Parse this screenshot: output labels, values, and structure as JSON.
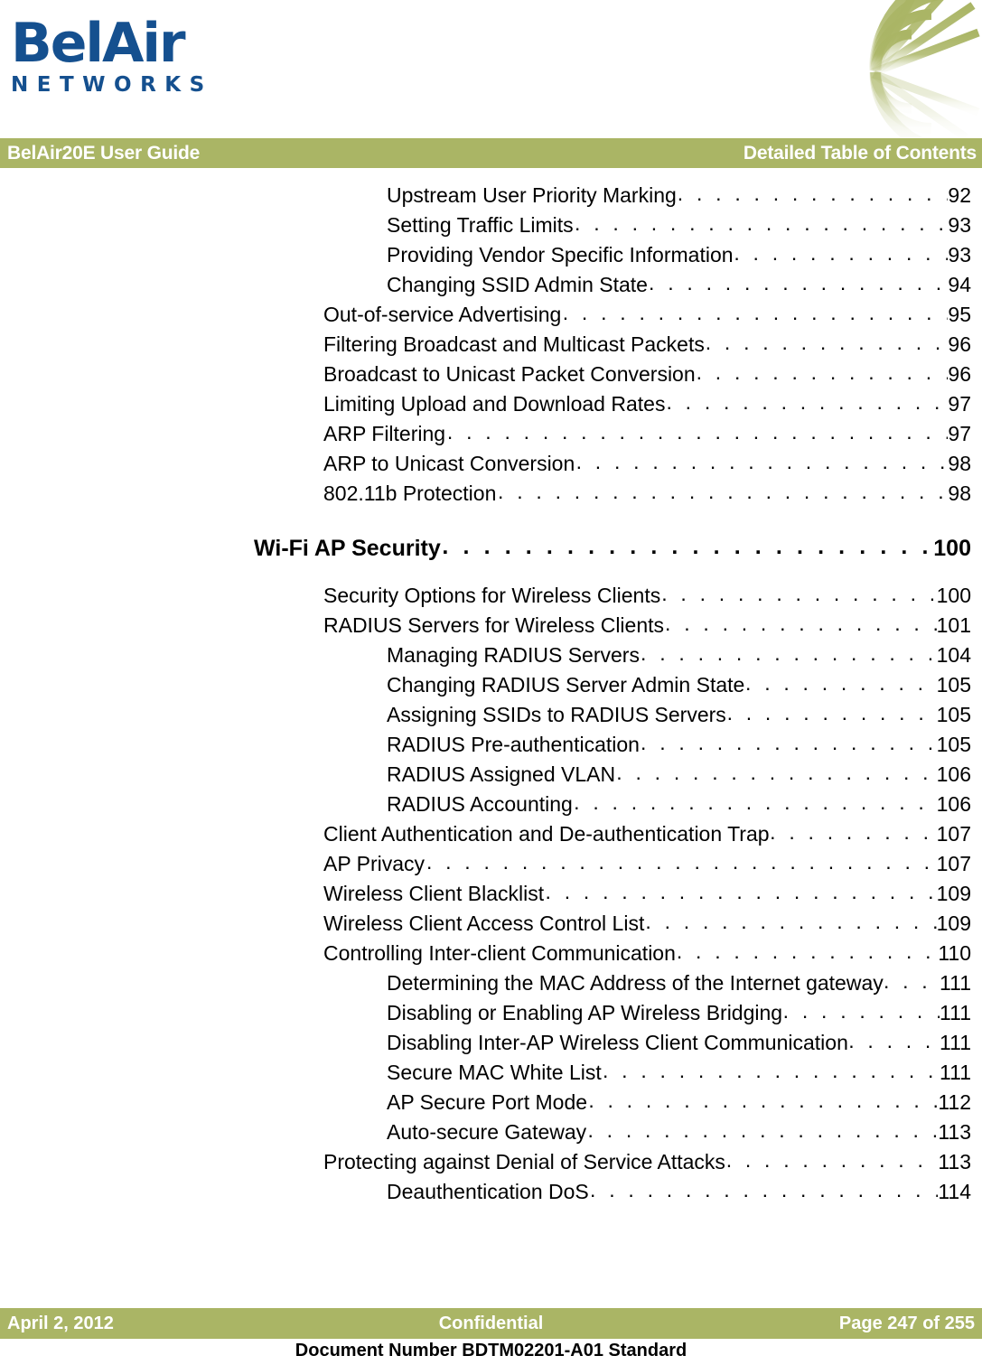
{
  "masthead": {
    "logo_word": "BelAir",
    "logo_sub": "NETWORKS",
    "logo_color": "#15508F",
    "brandmark_icon": "wireless-web-graphic",
    "brandmark_color": "#AAB565"
  },
  "header": {
    "left_title": "BelAir20E User Guide",
    "right_title": "Detailed Table of Contents",
    "band_color": "#AAB565",
    "text_color": "#FFFFFF"
  },
  "toc": {
    "leader_dots": ". . . . . . . . . . . . . . . . . . . . . . . . . . . . . . . . . . . . . . . . . . . . . . . . . . . . . . . . . . . . . . . . . . . . . . . . . . . . . . . . . . . . . .",
    "entries": [
      {
        "level": 2,
        "title": "Upstream User Priority Marking",
        "page": "92"
      },
      {
        "level": 2,
        "title": "Setting Traffic Limits",
        "page": "93"
      },
      {
        "level": 2,
        "title": "Providing Vendor Specific Information",
        "page": "93"
      },
      {
        "level": 2,
        "title": "Changing SSID Admin State",
        "page": "94"
      },
      {
        "level": 1,
        "title": "Out-of-service Advertising",
        "page": "95"
      },
      {
        "level": 1,
        "title": "Filtering Broadcast and Multicast Packets",
        "page": "96"
      },
      {
        "level": 1,
        "title": "Broadcast to Unicast Packet Conversion",
        "page": "96"
      },
      {
        "level": 1,
        "title": "Limiting Upload and Download Rates",
        "page": "97"
      },
      {
        "level": 1,
        "title": "ARP Filtering",
        "page": "97"
      },
      {
        "level": 1,
        "title": "ARP to Unicast Conversion",
        "page": "98"
      },
      {
        "level": 1,
        "title": "802.11b Protection",
        "page": "98"
      },
      {
        "level": 0,
        "title": "Wi-Fi AP Security",
        "page": "100",
        "gap_before": true
      },
      {
        "level": 1,
        "title": "Security Options for Wireless Clients",
        "page": "100",
        "gap_before": true
      },
      {
        "level": 1,
        "title": "RADIUS Servers for Wireless Clients",
        "page": "101"
      },
      {
        "level": 2,
        "title": "Managing RADIUS Servers",
        "page": "104"
      },
      {
        "level": 2,
        "title": "Changing RADIUS Server Admin State",
        "page": "105"
      },
      {
        "level": 2,
        "title": "Assigning SSIDs to RADIUS Servers",
        "page": "105"
      },
      {
        "level": 2,
        "title": "RADIUS Pre-authentication",
        "page": "105"
      },
      {
        "level": 2,
        "title": "RADIUS Assigned VLAN",
        "page": "106"
      },
      {
        "level": 2,
        "title": "RADIUS Accounting",
        "page": "106"
      },
      {
        "level": 1,
        "title": "Client Authentication and De-authentication Trap",
        "page": "107"
      },
      {
        "level": 1,
        "title": "AP Privacy",
        "page": "107"
      },
      {
        "level": 1,
        "title": "Wireless Client Blacklist",
        "page": "109"
      },
      {
        "level": 1,
        "title": "Wireless Client Access Control List",
        "page": "109"
      },
      {
        "level": 1,
        "title": "Controlling Inter-client Communication",
        "page": "110"
      },
      {
        "level": 2,
        "title": "Determining the MAC Address of the Internet gateway",
        "page": "111"
      },
      {
        "level": 2,
        "title": "Disabling or Enabling AP Wireless Bridging",
        "page": "111"
      },
      {
        "level": 2,
        "title": "Disabling Inter-AP Wireless Client Communication",
        "page": "111"
      },
      {
        "level": 2,
        "title": "Secure MAC White List",
        "page": "111"
      },
      {
        "level": 2,
        "title": "AP Secure Port Mode",
        "page": "112"
      },
      {
        "level": 2,
        "title": "Auto-secure Gateway",
        "page": "113"
      },
      {
        "level": 1,
        "title": "Protecting against Denial of Service Attacks",
        "page": "113"
      },
      {
        "level": 2,
        "title": "Deauthentication DoS",
        "page": "114"
      }
    ]
  },
  "footer": {
    "date": "April 2, 2012",
    "classification": "Confidential",
    "page_label": "Page 247 of 255",
    "document_number": "Document Number BDTM02201-A01 Standard",
    "band_color": "#AAB565"
  }
}
